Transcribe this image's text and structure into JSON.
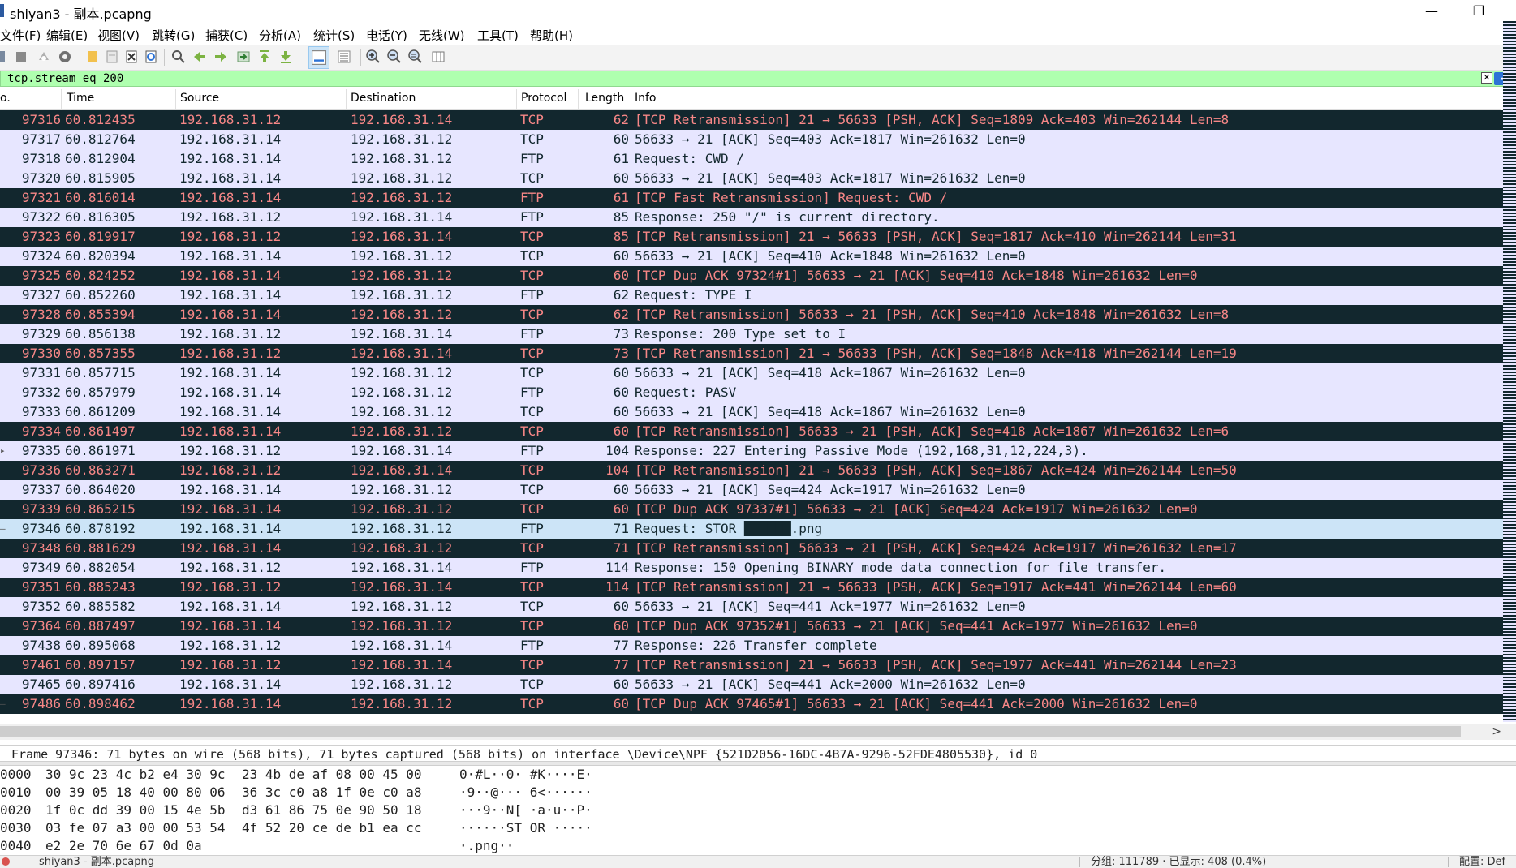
{
  "window": {
    "title": "shiyan3 - 副本.pcapng",
    "minimize": "—",
    "restore": "❐",
    "close": "✕"
  },
  "menu": [
    "文件(F)",
    "编辑(E)",
    "视图(V)",
    "跳转(G)",
    "捕获(C)",
    "分析(A)",
    "统计(S)",
    "电话(Y)",
    "无线(W)",
    "工具(T)",
    "帮助(H)"
  ],
  "toolbar_icons": [
    "start-capture-icon",
    "stop-capture-icon",
    "restart-capture-icon",
    "capture-options-icon",
    "open-file-icon",
    "save-file-icon",
    "close-file-icon",
    "reload-file-icon",
    "find-packet-icon",
    "go-back-icon",
    "go-forward-icon",
    "go-to-packet-icon",
    "go-first-icon",
    "go-last-icon",
    "autoscroll-icon",
    "colorize-icon",
    "zoom-in-icon",
    "zoom-out-icon",
    "zoom-normal-icon",
    "resize-columns-icon"
  ],
  "filter": {
    "value": "tcp.stream eq 200",
    "clear": "✕",
    "apply": "➡"
  },
  "columns": {
    "no": "o.",
    "time": "Time",
    "source": "Source",
    "destination": "Destination",
    "protocol": "Protocol",
    "length": "Length",
    "info": "Info"
  },
  "packets": [
    {
      "no": "97316",
      "time": "60.812435",
      "src": "192.168.31.12",
      "dst": "192.168.31.14",
      "proto": "TCP",
      "len": "62",
      "info": "[TCP Retransmission] 21 → 56633 [PSH, ACK] Seq=1809 Ack=403 Win=262144 Len=8",
      "style": "dark"
    },
    {
      "no": "97317",
      "time": "60.812764",
      "src": "192.168.31.14",
      "dst": "192.168.31.12",
      "proto": "TCP",
      "len": "60",
      "info": "56633 → 21 [ACK] Seq=403 Ack=1817 Win=261632 Len=0",
      "style": "light"
    },
    {
      "no": "97318",
      "time": "60.812904",
      "src": "192.168.31.14",
      "dst": "192.168.31.12",
      "proto": "FTP",
      "len": "61",
      "info": "Request: CWD /",
      "style": "light"
    },
    {
      "no": "97320",
      "time": "60.815905",
      "src": "192.168.31.14",
      "dst": "192.168.31.12",
      "proto": "TCP",
      "len": "60",
      "info": "56633 → 21 [ACK] Seq=403 Ack=1817 Win=261632 Len=0",
      "style": "light"
    },
    {
      "no": "97321",
      "time": "60.816014",
      "src": "192.168.31.14",
      "dst": "192.168.31.12",
      "proto": "FTP",
      "len": "61",
      "info": "[TCP Fast Retransmission] Request: CWD /",
      "style": "dark"
    },
    {
      "no": "97322",
      "time": "60.816305",
      "src": "192.168.31.12",
      "dst": "192.168.31.14",
      "proto": "FTP",
      "len": "85",
      "info": "Response: 250 \"/\" is current directory.",
      "style": "light"
    },
    {
      "no": "97323",
      "time": "60.819917",
      "src": "192.168.31.12",
      "dst": "192.168.31.14",
      "proto": "TCP",
      "len": "85",
      "info": "[TCP Retransmission] 21 → 56633 [PSH, ACK] Seq=1817 Ack=410 Win=262144 Len=31",
      "style": "dark"
    },
    {
      "no": "97324",
      "time": "60.820394",
      "src": "192.168.31.14",
      "dst": "192.168.31.12",
      "proto": "TCP",
      "len": "60",
      "info": "56633 → 21 [ACK] Seq=410 Ack=1848 Win=261632 Len=0",
      "style": "light"
    },
    {
      "no": "97325",
      "time": "60.824252",
      "src": "192.168.31.14",
      "dst": "192.168.31.12",
      "proto": "TCP",
      "len": "60",
      "info": "[TCP Dup ACK 97324#1] 56633 → 21 [ACK] Seq=410 Ack=1848 Win=261632 Len=0",
      "style": "dark"
    },
    {
      "no": "97327",
      "time": "60.852260",
      "src": "192.168.31.14",
      "dst": "192.168.31.12",
      "proto": "FTP",
      "len": "62",
      "info": "Request: TYPE I",
      "style": "light"
    },
    {
      "no": "97328",
      "time": "60.855394",
      "src": "192.168.31.14",
      "dst": "192.168.31.12",
      "proto": "TCP",
      "len": "62",
      "info": "[TCP Retransmission] 56633 → 21 [PSH, ACK] Seq=410 Ack=1848 Win=261632 Len=8",
      "style": "dark"
    },
    {
      "no": "97329",
      "time": "60.856138",
      "src": "192.168.31.12",
      "dst": "192.168.31.14",
      "proto": "FTP",
      "len": "73",
      "info": "Response: 200 Type set to I",
      "style": "light"
    },
    {
      "no": "97330",
      "time": "60.857355",
      "src": "192.168.31.12",
      "dst": "192.168.31.14",
      "proto": "TCP",
      "len": "73",
      "info": "[TCP Retransmission] 21 → 56633 [PSH, ACK] Seq=1848 Ack=418 Win=262144 Len=19",
      "style": "dark"
    },
    {
      "no": "97331",
      "time": "60.857715",
      "src": "192.168.31.14",
      "dst": "192.168.31.12",
      "proto": "TCP",
      "len": "60",
      "info": "56633 → 21 [ACK] Seq=418 Ack=1867 Win=261632 Len=0",
      "style": "light"
    },
    {
      "no": "97332",
      "time": "60.857979",
      "src": "192.168.31.14",
      "dst": "192.168.31.12",
      "proto": "FTP",
      "len": "60",
      "info": "Request: PASV",
      "style": "light"
    },
    {
      "no": "97333",
      "time": "60.861209",
      "src": "192.168.31.14",
      "dst": "192.168.31.12",
      "proto": "TCP",
      "len": "60",
      "info": "56633 → 21 [ACK] Seq=418 Ack=1867 Win=261632 Len=0",
      "style": "light"
    },
    {
      "no": "97334",
      "time": "60.861497",
      "src": "192.168.31.14",
      "dst": "192.168.31.12",
      "proto": "TCP",
      "len": "60",
      "info": "[TCP Retransmission] 56633 → 21 [PSH, ACK] Seq=418 Ack=1867 Win=261632 Len=6",
      "style": "dark"
    },
    {
      "no": "97335",
      "time": "60.861971",
      "src": "192.168.31.12",
      "dst": "192.168.31.14",
      "proto": "FTP",
      "len": "104",
      "info": "Response: 227 Entering Passive Mode (192,168,31,12,224,3).",
      "style": "light",
      "mark": "▸"
    },
    {
      "no": "97336",
      "time": "60.863271",
      "src": "192.168.31.12",
      "dst": "192.168.31.14",
      "proto": "TCP",
      "len": "104",
      "info": "[TCP Retransmission] 21 → 56633 [PSH, ACK] Seq=1867 Ack=424 Win=262144 Len=50",
      "style": "dark"
    },
    {
      "no": "97337",
      "time": "60.864020",
      "src": "192.168.31.14",
      "dst": "192.168.31.12",
      "proto": "TCP",
      "len": "60",
      "info": "56633 → 21 [ACK] Seq=424 Ack=1917 Win=261632 Len=0",
      "style": "light"
    },
    {
      "no": "97339",
      "time": "60.865215",
      "src": "192.168.31.14",
      "dst": "192.168.31.12",
      "proto": "TCP",
      "len": "60",
      "info": "[TCP Dup ACK 97337#1] 56633 → 21 [ACK] Seq=424 Ack=1917 Win=261632 Len=0",
      "style": "dark"
    },
    {
      "no": "97346",
      "time": "60.878192",
      "src": "192.168.31.14",
      "dst": "192.168.31.12",
      "proto": "FTP",
      "len": "71",
      "info": "Request: STOR ██████.png",
      "style": "sel",
      "mark": "—"
    },
    {
      "no": "97348",
      "time": "60.881629",
      "src": "192.168.31.14",
      "dst": "192.168.31.12",
      "proto": "TCP",
      "len": "71",
      "info": "[TCP Retransmission] 56633 → 21 [PSH, ACK] Seq=424 Ack=1917 Win=261632 Len=17",
      "style": "dark"
    },
    {
      "no": "97349",
      "time": "60.882054",
      "src": "192.168.31.12",
      "dst": "192.168.31.14",
      "proto": "FTP",
      "len": "114",
      "info": "Response: 150 Opening BINARY mode data connection for file transfer.",
      "style": "light"
    },
    {
      "no": "97351",
      "time": "60.885243",
      "src": "192.168.31.12",
      "dst": "192.168.31.14",
      "proto": "TCP",
      "len": "114",
      "info": "[TCP Retransmission] 21 → 56633 [PSH, ACK] Seq=1917 Ack=441 Win=262144 Len=60",
      "style": "dark"
    },
    {
      "no": "97352",
      "time": "60.885582",
      "src": "192.168.31.14",
      "dst": "192.168.31.12",
      "proto": "TCP",
      "len": "60",
      "info": "56633 → 21 [ACK] Seq=441 Ack=1977 Win=261632 Len=0",
      "style": "light"
    },
    {
      "no": "97364",
      "time": "60.887497",
      "src": "192.168.31.14",
      "dst": "192.168.31.12",
      "proto": "TCP",
      "len": "60",
      "info": "[TCP Dup ACK 97352#1] 56633 → 21 [ACK] Seq=441 Ack=1977 Win=261632 Len=0",
      "style": "dark"
    },
    {
      "no": "97438",
      "time": "60.895068",
      "src": "192.168.31.12",
      "dst": "192.168.31.14",
      "proto": "FTP",
      "len": "77",
      "info": "Response: 226 Transfer complete",
      "style": "light"
    },
    {
      "no": "97461",
      "time": "60.897157",
      "src": "192.168.31.12",
      "dst": "192.168.31.14",
      "proto": "TCP",
      "len": "77",
      "info": "[TCP Retransmission] 21 → 56633 [PSH, ACK] Seq=1977 Ack=441 Win=262144 Len=23",
      "style": "dark"
    },
    {
      "no": "97465",
      "time": "60.897416",
      "src": "192.168.31.14",
      "dst": "192.168.31.12",
      "proto": "TCP",
      "len": "60",
      "info": "56633 → 21 [ACK] Seq=441 Ack=2000 Win=261632 Len=0",
      "style": "light"
    },
    {
      "no": "97486",
      "time": "60.898462",
      "src": "192.168.31.14",
      "dst": "192.168.31.12",
      "proto": "TCP",
      "len": "60",
      "info": "[TCP Dup ACK 97465#1] 56633 → 21 [ACK] Seq=441 Ack=2000 Win=261632 Len=0",
      "style": "dark",
      "mark": "—"
    }
  ],
  "hscroll_arrow": ">",
  "detail": {
    "frame_line": "Frame 97346: 71 bytes on wire (568 bits), 71 bytes captured (568 bits) on interface \\Device\\NPF_{521D2056-16DC-4B7A-9296-52FDE4805530}, id 0"
  },
  "bytes": [
    {
      "off": "0000",
      "hex1": "30 9c 23 4c b2 e4 30 9c",
      "hex2": "23 4b de af 08 00 45 00",
      "ascii": "0·#L··0· #K····E·"
    },
    {
      "off": "0010",
      "hex1": "00 39 05 18 40 00 80 06",
      "hex2": "36 3c c0 a8 1f 0e c0 a8",
      "ascii": "·9··@··· 6<······"
    },
    {
      "off": "0020",
      "hex1": "1f 0c dd 39 00 15 4e 5b",
      "hex2": "d3 61 86 75 0e 90 50 18",
      "ascii": "···9··N[ ·a·u··P·"
    },
    {
      "off": "0030",
      "hex1": "03 fe 07 a3 00 00 53 54",
      "hex2": "4f 52 20 ce de b1 ea cc",
      "ascii": "······ST OR ·····"
    },
    {
      "off": "0040",
      "hex1": "e2 2e 70 6e 67 0d 0a",
      "hex2": "",
      "ascii": "·.png··"
    }
  ],
  "status": {
    "file": "shiyan3 - 副本.pcapng",
    "packets": "分组: 111789 · 已显示: 408 (0.4%)",
    "profile": "配置: Def"
  }
}
